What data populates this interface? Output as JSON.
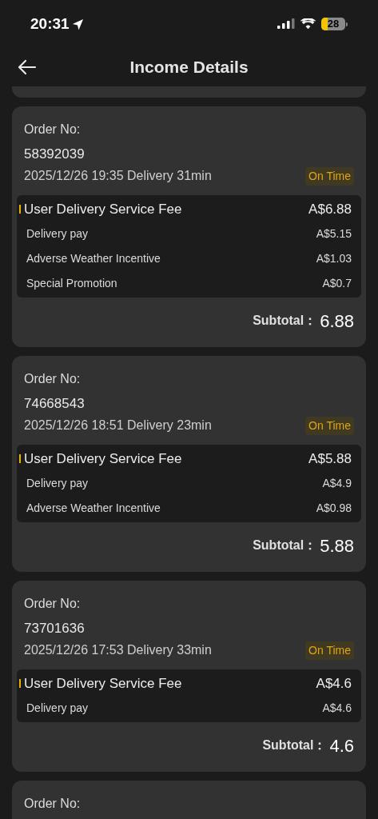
{
  "status_bar": {
    "time": "20:31",
    "battery": "28"
  },
  "header": {
    "title": "Income Details"
  },
  "orders": [
    {
      "label": "Order No:",
      "number": "58392039",
      "info": "2025/12/26 19:35 Delivery 31min",
      "badge": "On Time",
      "fees": [
        {
          "kind": "primary",
          "name": "User Delivery Service Fee",
          "amount": "A$6.88"
        },
        {
          "kind": "sub",
          "name": "Delivery pay",
          "amount": "A$5.15"
        },
        {
          "kind": "sub",
          "name": "Adverse Weather Incentive",
          "amount": "A$1.03"
        },
        {
          "kind": "sub",
          "name": "Special Promotion",
          "amount": "A$0.7"
        }
      ],
      "subtotal_label": "Subtotal：",
      "subtotal": "6.88"
    },
    {
      "label": "Order No:",
      "number": "74668543",
      "info": "2025/12/26 18:51 Delivery 23min",
      "badge": "On Time",
      "fees": [
        {
          "kind": "primary",
          "name": "User Delivery Service Fee",
          "amount": "A$5.88"
        },
        {
          "kind": "sub",
          "name": "Delivery pay",
          "amount": "A$4.9"
        },
        {
          "kind": "sub",
          "name": "Adverse Weather Incentive",
          "amount": "A$0.98"
        }
      ],
      "subtotal_label": "Subtotal：",
      "subtotal": "5.88"
    },
    {
      "label": "Order No:",
      "number": "73701636",
      "info": "2025/12/26 17:53 Delivery 33min",
      "badge": "On Time",
      "fees": [
        {
          "kind": "primary",
          "name": "User Delivery Service Fee",
          "amount": "A$4.6"
        },
        {
          "kind": "sub",
          "name": "Delivery pay",
          "amount": "A$4.6"
        }
      ],
      "subtotal_label": "Subtotal：",
      "subtotal": "4.6"
    },
    {
      "label": "Order No:"
    }
  ]
}
